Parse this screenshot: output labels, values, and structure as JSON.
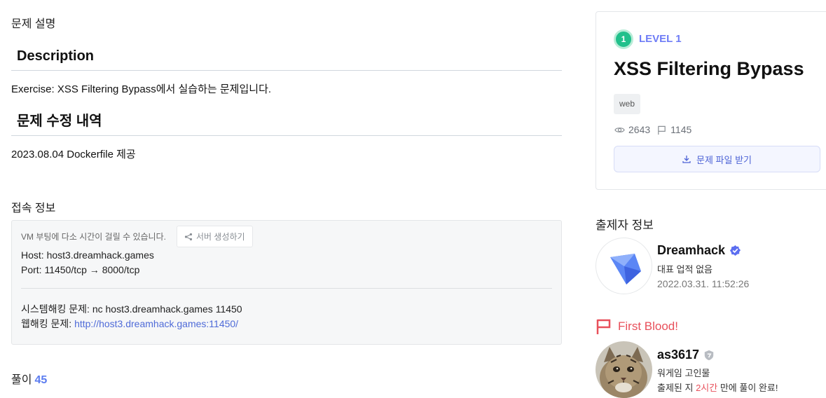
{
  "left": {
    "problem_section": "문제 설명",
    "description_heading": "Description",
    "description_text": "Exercise: XSS Filtering Bypass에서 실습하는 문제입니다.",
    "modification_heading": "문제 수정 내역",
    "modification_text": "2023.08.04 Dockerfile 제공",
    "connection_section": "접속 정보",
    "connection": {
      "vm_note": "VM 부팅에 다소 시간이 걸릴 수 있습니다.",
      "generate_button": "서버 생성하기",
      "host_line": "Host: host3.dreamhack.games",
      "port_line": "Port:  11450/tcp → 8000/tcp",
      "system_line": "시스템해킹 문제: nc host3.dreamhack.games 11450",
      "web_prefix": "웹해킹 문제: ",
      "web_link": "http://host3.dreamhack.games:11450/"
    },
    "solve_label": "풀이",
    "solve_count": "45"
  },
  "card": {
    "level_number": "1",
    "level_text": "LEVEL 1",
    "title": "XSS Filtering Bypass",
    "tag": "web",
    "views": "2643",
    "solves": "1145",
    "download_button": "문제 파일 받기",
    "level_color": "#21c08b",
    "accent_color": "#6e7cf6"
  },
  "author": {
    "heading": "출제자 정보",
    "name": "Dreamhack",
    "description": "대표 업적 없음",
    "date": "2022.03.31. 11:52:26"
  },
  "first_blood": {
    "heading": "First Blood!",
    "name": "as3617",
    "description": "워게임 고인물",
    "time_prefix": "출제된 지 ",
    "time_highlight": "2시간",
    "time_suffix": " 만에 풀이 완료!",
    "accent_color": "#e8505b"
  }
}
